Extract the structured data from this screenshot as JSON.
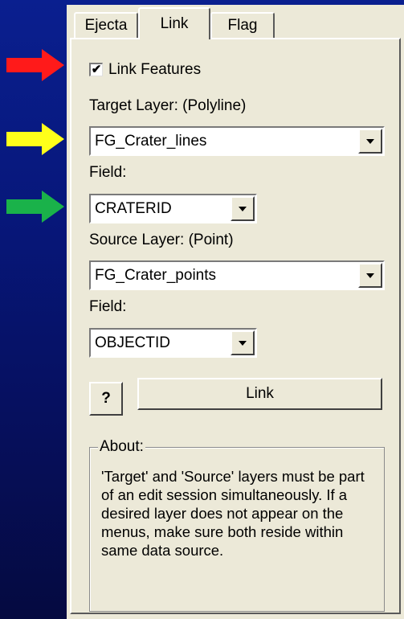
{
  "tabs": [
    {
      "label": "Ejecta",
      "active": false
    },
    {
      "label": "Link",
      "active": true
    },
    {
      "label": "Flag",
      "active": false
    }
  ],
  "link_features": {
    "label": "Link Features",
    "checked": true
  },
  "target_layer": {
    "label": "Target Layer: (Polyline)",
    "value": "FG_Crater_lines"
  },
  "target_field": {
    "label": "Field:",
    "value": "CRATERID"
  },
  "source_layer": {
    "label": "Source Layer: (Point)",
    "value": "FG_Crater_points"
  },
  "source_field": {
    "label": "Field:",
    "value": "OBJECTID"
  },
  "help_button": {
    "label": "?"
  },
  "link_button": {
    "label": "Link"
  },
  "about": {
    "legend": "About:",
    "text": "'Target' and 'Source' layers must be part of an edit session simultaneously. If a desired layer does not appear on the menus, make sure both reside within same data source."
  },
  "colors": {
    "background": "#0a1f8f",
    "panel": "#ece9d8",
    "arrow_red": "#ff1a1a",
    "arrow_yellow": "#ffff1a",
    "arrow_green": "#1ab24a"
  },
  "icons": {
    "annotation_arrow": "arrow-right-icon",
    "combo_dropdown": "triangle-down-icon"
  }
}
